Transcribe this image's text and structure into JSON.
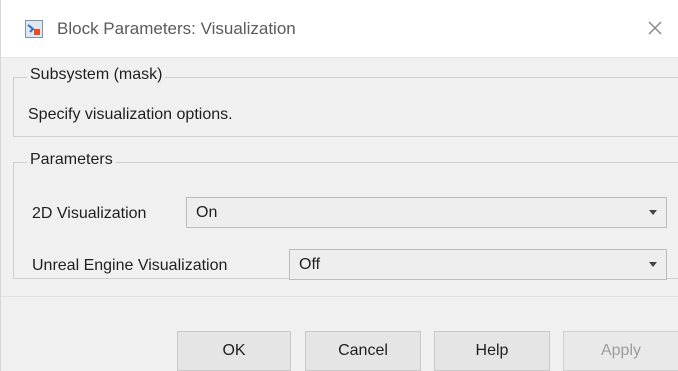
{
  "window": {
    "title": "Block Parameters: Visualization",
    "icon": "simulink-block-icon",
    "close_icon": "close-icon"
  },
  "mask_group": {
    "legend": "Subsystem (mask)",
    "description": "Specify visualization options."
  },
  "parameters_group": {
    "legend": "Parameters",
    "params": [
      {
        "label": "2D Visualization",
        "value": "On"
      },
      {
        "label": "Unreal Engine Visualization",
        "value": "Off"
      }
    ]
  },
  "buttons": {
    "ok": "OK",
    "cancel": "Cancel",
    "help": "Help",
    "apply": "Apply",
    "apply_enabled": false
  },
  "colors": {
    "background": "#f0f0f0",
    "titlebar": "#ffffff",
    "border": "#cfcfcf",
    "disabled_text": "#9c9c9c"
  }
}
